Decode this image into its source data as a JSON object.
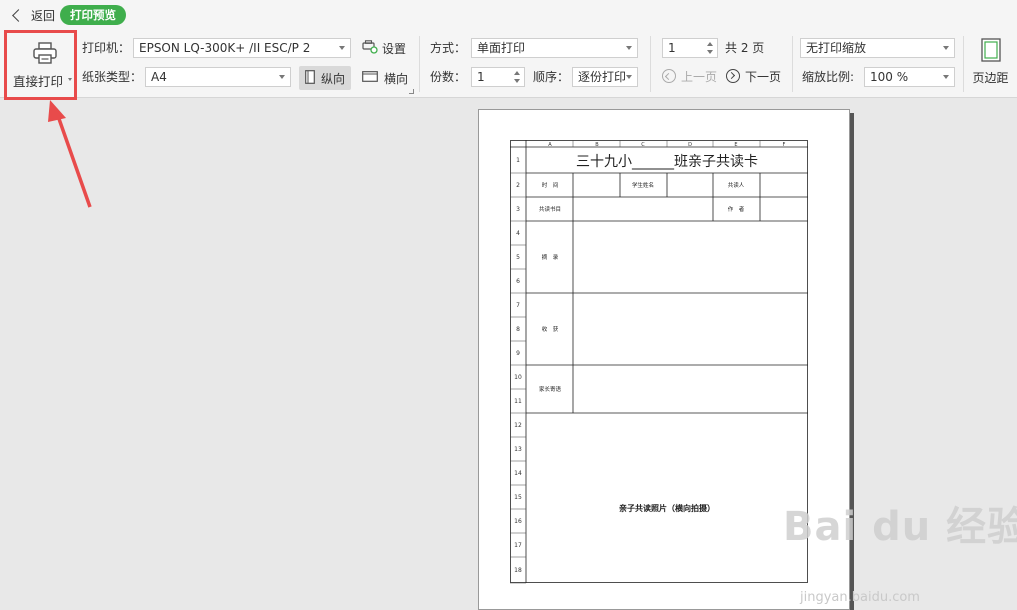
{
  "topbar": {
    "back_label": "返回",
    "mode_pill": "打印预览"
  },
  "ribbon": {
    "direct_print_label": "直接打印",
    "printer_label": "打印机：",
    "printer_value": "EPSON LQ-300K+ /II ESC/P 2",
    "paper_label": "纸张类型：",
    "paper_value": "A4",
    "settings_label": "设置",
    "portrait_label": "纵向",
    "landscape_label": "横向",
    "method_label": "方式：",
    "method_value": "单面打印",
    "copies_label": "份数：",
    "copies_value": "1",
    "order_label": "顺序：",
    "order_value": "逐份打印",
    "page_value": "1",
    "total_pages": "共 2 页",
    "prev_page": "上一页",
    "next_page": "下一页",
    "scale_mode_value": "无打印缩放",
    "scale_label": "缩放比例:",
    "scale_value": "100 %",
    "margins_label": "页边距"
  },
  "sheet": {
    "columns": [
      "A",
      "B",
      "C",
      "D",
      "E",
      "F"
    ],
    "rows": [
      "1",
      "2",
      "3",
      "4",
      "5",
      "6",
      "7",
      "8",
      "9",
      "10",
      "11",
      "12",
      "13",
      "14",
      "15",
      "16",
      "17",
      "18"
    ],
    "title": "三十九小______班亲子共读卡",
    "time": "时　间",
    "student_name": "学生姓名",
    "co_reader": "共读人",
    "book_title": "共读书目",
    "author": "作　者",
    "excerpt": "摘　录",
    "harvest": "收　获",
    "parent_msg": "家长寄语",
    "photo": "亲子共读照片（横向拍摄）"
  },
  "watermark": {
    "main": "Bai du 经验",
    "sub": "jingyan.baidu.com"
  },
  "colors": {
    "accent_green": "#3fae4c",
    "highlight_red": "#e84b4b"
  }
}
